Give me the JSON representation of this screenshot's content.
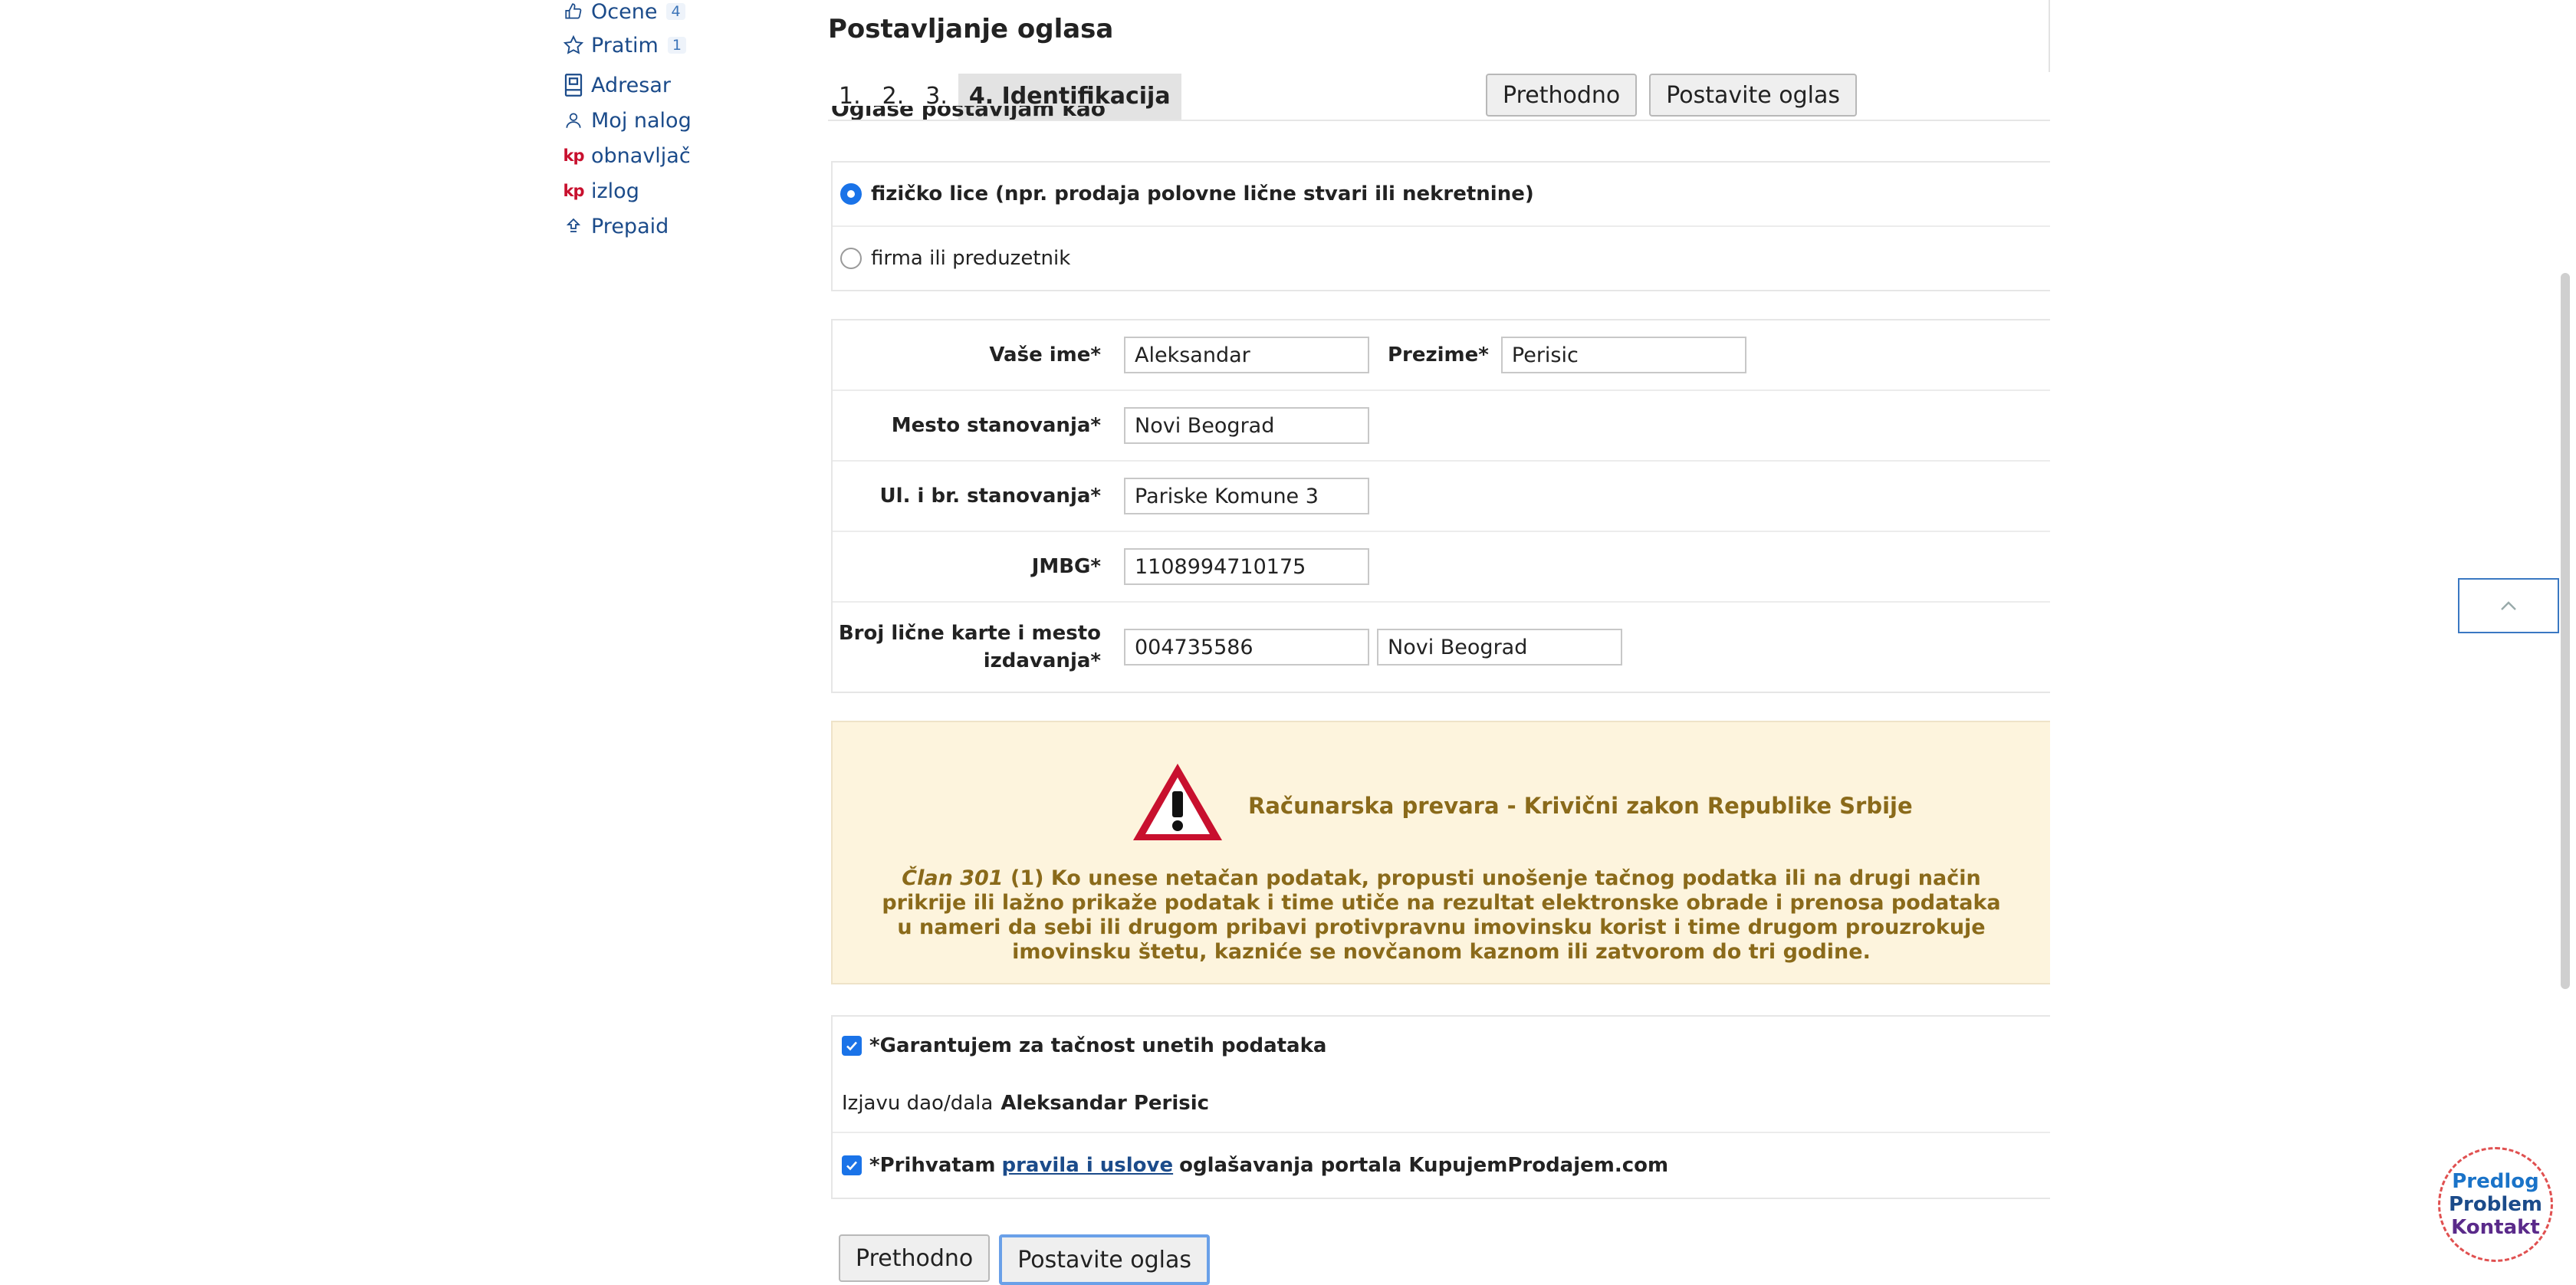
{
  "sidebar": {
    "items": [
      {
        "label": "Ocene",
        "icon": "thumbs-up-icon",
        "count": "4"
      },
      {
        "label": "Pratim",
        "icon": "star-icon",
        "count": "1"
      },
      {
        "label": "Adresar",
        "icon": "address-book-icon"
      },
      {
        "label": "Moj nalog",
        "icon": "user-icon"
      },
      {
        "label": "obnavljač",
        "icon": "kp-logo-icon",
        "icon_text": "kp"
      },
      {
        "label": "izlog",
        "icon": "kp-logo-icon",
        "icon_text": "kp"
      },
      {
        "label": "Prepaid",
        "icon": "upload-arrow-icon"
      }
    ]
  },
  "page": {
    "title": "Postavljanje oglasa"
  },
  "steps": {
    "items": [
      "1.",
      "2.",
      "3.",
      "4. Identifikacija"
    ],
    "active_index": 3,
    "prev_label": "Prethodno",
    "submit_label": "Postavite oglas"
  },
  "section_cut_heading": "Oglase postavljam kao",
  "account_type": {
    "options": [
      {
        "label": "fizičko lice (npr. prodaja polovne lične stvari ili nekretnine)",
        "checked": true
      },
      {
        "label": "firma ili preduzetnik",
        "checked": false
      }
    ]
  },
  "form": {
    "first_name_label": "Vaše ime*",
    "first_name_value": "Aleksandar",
    "last_name_label": "Prezime*",
    "last_name_value": "Perisic",
    "city_label": "Mesto stanovanja*",
    "city_value": "Novi Beograd",
    "street_label": "Ul. i br. stanovanja*",
    "street_value": "Pariske Komune 3",
    "jmbg_label": "JMBG*",
    "jmbg_value": "1108994710175",
    "id_label_line1": "Broj lične karte i mesto",
    "id_label_line2": "izdavanja*",
    "id_number_value": "004735586",
    "id_place_value": "Novi Beograd"
  },
  "warning": {
    "title": "Računarska prevara - Krivični zakon Republike Srbije",
    "article": "Član 301",
    "text": "(1) Ko unese netačan podatak, propusti unošenje tačnog podatka ili na drugi način prikrije ili lažno prikaže podatak i time utiče na rezultat elektronske obrade i prenosa podataka u nameri da sebi ili drugom pribavi protivpravnu imovinsku korist i time drugom prouzrokuje imovinsku štetu, kazniće se novčanom kaznom ili zatvorom do tri godine."
  },
  "consent": {
    "guarantee_label": "*Garantujem za tačnost unetih podataka",
    "guarantee_checked": true,
    "statement_prefix": "Izjavu dao/dala",
    "statement_name": "Aleksandar Perisic",
    "terms_prefix": "*Prihvatam",
    "terms_link": "pravila i uslove",
    "terms_suffix": "oglašavanja portala KupujemProdajem.com",
    "terms_checked": true
  },
  "bottom": {
    "prev_label": "Prethodno",
    "submit_label": "Postavite oglas"
  },
  "feedback": {
    "line1": "Predlog",
    "line2": "Problem",
    "line3": "Kontakt"
  },
  "colors": {
    "link": "#1b4b8a",
    "warning_text": "#8a6a1a",
    "warning_bg": "#fdf4dd",
    "checkbox": "#1a73e8"
  }
}
